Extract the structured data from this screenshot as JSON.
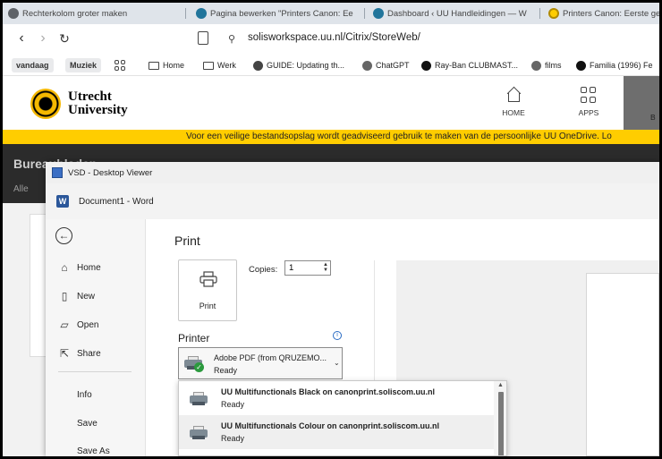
{
  "browser": {
    "tabs": [
      {
        "label": "Rechterkolom groter maken",
        "icon": "settings-favicon",
        "color": "#5f6368"
      },
      {
        "label": "Pagina bewerken \"Printers Canon: Ee",
        "icon": "wordpress-favicon",
        "color": "#21759b"
      },
      {
        "label": "Dashboard ‹ UU Handleidingen — W",
        "icon": "wordpress-favicon",
        "color": "#21759b"
      },
      {
        "label": "Printers Canon: Eerste ge",
        "icon": "uu-favicon",
        "color": "#ffcd00"
      }
    ],
    "url": "solisworkspace.uu.nl/Citrix/StoreWeb/",
    "bookmarks": [
      {
        "label": "vandaag",
        "type": "pill"
      },
      {
        "label": "Muziek",
        "type": "pill"
      },
      {
        "label": "Home",
        "type": "folder"
      },
      {
        "label": "Werk",
        "type": "folder"
      },
      {
        "label": "GUIDE: Updating th...",
        "type": "site"
      },
      {
        "label": "ChatGPT",
        "type": "site"
      },
      {
        "label": "Ray-Ban CLUBMAST...",
        "type": "site"
      },
      {
        "label": "films",
        "type": "site"
      },
      {
        "label": "Familia (1996) Fe",
        "type": "site"
      }
    ]
  },
  "uu": {
    "logo_line1": "Utrecht",
    "logo_line2": "University",
    "nav_home": "HOME",
    "nav_apps": "APPS",
    "nav_partial": "B",
    "banner": "Voor een veilige bestandsopslag wordt geadviseerd gebruik te maken van de persoonlijke UU OneDrive. Lo",
    "section_title": "Bureaubladen",
    "section_sub": "Alle"
  },
  "vsd": {
    "title": "VSD - Desktop Viewer",
    "doc_title": "Document1  -  Word",
    "menu": [
      {
        "label": "Home",
        "icon": "home-icon"
      },
      {
        "label": "New",
        "icon": "new-doc-icon"
      },
      {
        "label": "Open",
        "icon": "folder-open-icon"
      },
      {
        "label": "Share",
        "icon": "share-icon"
      },
      {
        "label": "Info",
        "icon": ""
      },
      {
        "label": "Save",
        "icon": ""
      },
      {
        "label": "Save As",
        "icon": ""
      }
    ],
    "print": {
      "heading": "Print",
      "button_label": "Print",
      "copies_label": "Copies:",
      "copies_value": "1",
      "printer_label": "Printer",
      "selected_printer": "Adobe PDF (from QRUZEMO...",
      "selected_status": "Ready",
      "printers": [
        {
          "name": "UU Multifunctionals Black on canonprint.soliscom.uu.nl",
          "status": "Ready"
        },
        {
          "name": "UU Multifunctionals Colour on canonprint.soliscom.uu.nl",
          "status": "Ready"
        }
      ]
    }
  },
  "colors": {
    "uu_yellow": "#ffcd00",
    "word_blue": "#2b579a",
    "ready_green": "#2b9a3e"
  }
}
